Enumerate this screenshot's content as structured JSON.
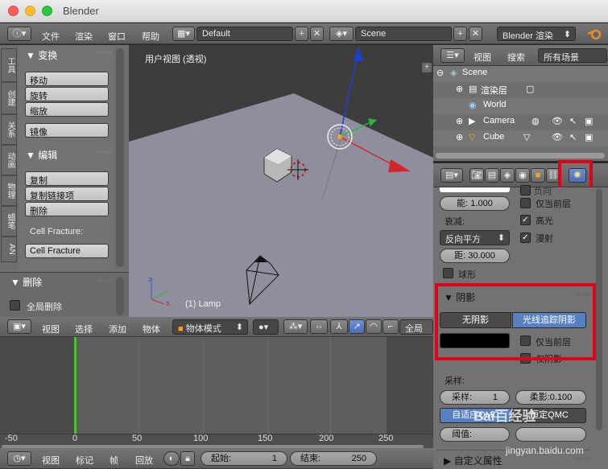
{
  "window": {
    "title": "Blender"
  },
  "top_header": {
    "menus": [
      "文件",
      "渲染",
      "窗口",
      "帮助"
    ],
    "layout": "Default",
    "scene": "Scene",
    "engine": "Blender 渲染"
  },
  "toolshelf": {
    "tabs": [
      "工具",
      "创建",
      "关系",
      "动画",
      "物理",
      "蜡笔",
      "AN"
    ],
    "transform_title": "▼ 变换",
    "transform_buttons": [
      "移动",
      "旋转",
      "缩放"
    ],
    "mirror_button": "镜像",
    "edit_title": "▼ 编辑",
    "edit_buttons": [
      "复制",
      "复制链接项",
      "删除"
    ],
    "cell_fracture_label": "Cell Fracture:",
    "cell_fracture_button": "Cell Fracture",
    "delete_title": "▼ 删除",
    "global_delete_label": "全局删除"
  },
  "viewport": {
    "view_label": "用户视图 (透视)",
    "object_label": "(1) Lamp"
  },
  "view3d_header": {
    "menus": [
      "视图",
      "选择",
      "添加",
      "物体"
    ],
    "mode": "物体模式",
    "transform_space": "全局"
  },
  "timeline": {
    "ruler_ticks": [
      "-50",
      "0",
      "50",
      "100",
      "150",
      "200",
      "250"
    ],
    "menus": [
      "视图",
      "标记",
      "帧",
      "回放"
    ],
    "start_label": "起始:",
    "start_value": "1",
    "end_label": "结束:",
    "end_value": "250"
  },
  "outliner": {
    "menus": [
      "视图",
      "搜索"
    ],
    "filter": "所有场景",
    "rows": [
      "Scene",
      "渲染层",
      "World",
      "Camera",
      "Cube"
    ]
  },
  "properties": {
    "energy_label": "能:",
    "energy_value": "1.000",
    "this_layer_only": "仅当前层",
    "specular": "高光",
    "diffuse": "漫射",
    "falloff_label": "衰减:",
    "falloff_value": "反向平方",
    "distance_label": "距:",
    "distance_value": "30.000",
    "sphere_label": "球形",
    "shadow_title": "▼ 阴影",
    "no_shadow": "无阴影",
    "ray_shadow": "光线追踪阴影",
    "shadow_this_layer_only": "仅当前层",
    "only_shadow": "仅阴影",
    "sampling_label": "采样:",
    "samples_label": "采样:",
    "samples_value": "1",
    "soft_size_label": "柔影:",
    "soft_size_value": "0.100",
    "adaptive_qmc": "自适应QMC",
    "constant_qmc": "恒定QMC",
    "threshold_label": "阈值:",
    "custom_props_title": "▶ 自定义属性"
  },
  "colors": {
    "viewport_bg": "#3d3d3d",
    "floor": "#8e8e9c",
    "highlight_red": "#e0001a",
    "selected_blue": "#5680c2",
    "frame_green": "#4ec130"
  },
  "watermark": {
    "text": "Bai百经验",
    "subtext": "jingyan.baidu.com"
  }
}
